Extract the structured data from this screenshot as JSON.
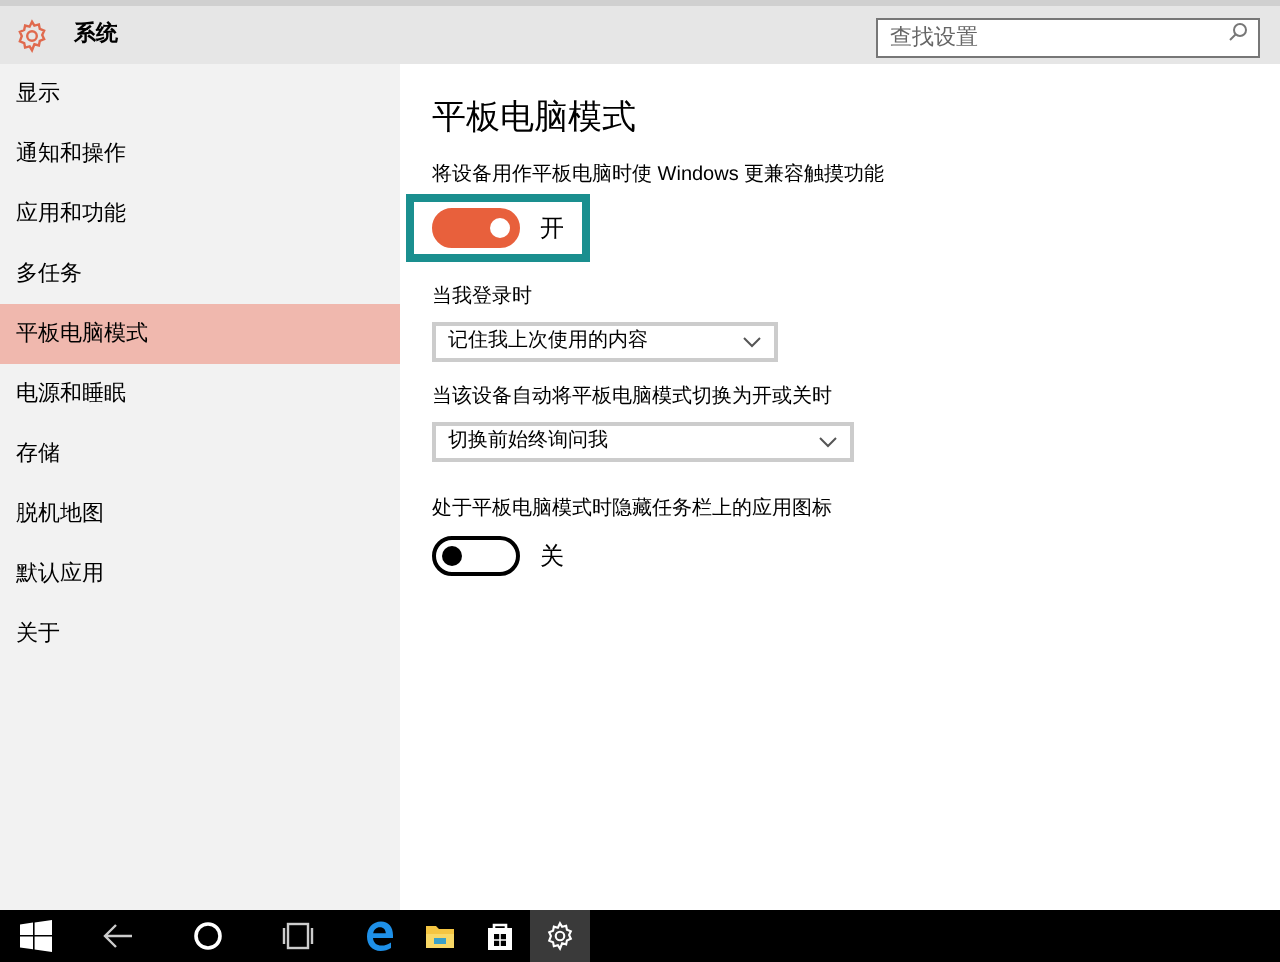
{
  "header": {
    "title": "系统",
    "search": {
      "placeholder": "查找设置"
    }
  },
  "sidebar": {
    "items": [
      {
        "label": "显示",
        "selected": false
      },
      {
        "label": "通知和操作",
        "selected": false
      },
      {
        "label": "应用和功能",
        "selected": false
      },
      {
        "label": "多任务",
        "selected": false
      },
      {
        "label": "平板电脑模式",
        "selected": true
      },
      {
        "label": "电源和睡眠",
        "selected": false
      },
      {
        "label": "存储",
        "selected": false
      },
      {
        "label": "脱机地图",
        "selected": false
      },
      {
        "label": "默认应用",
        "selected": false
      },
      {
        "label": "关于",
        "selected": false
      }
    ]
  },
  "page": {
    "title": "平板电脑模式",
    "settings": [
      {
        "kind": "toggle",
        "label": "将设备用作平板电脑时使 Windows 更兼容触摸功能",
        "on": true,
        "state_text": "开",
        "highlighted": true
      },
      {
        "kind": "dropdown",
        "label": "当我登录时",
        "value": "记住我上次使用的内容",
        "wide": false
      },
      {
        "kind": "dropdown",
        "label": "当该设备自动将平板电脑模式切换为开或关时",
        "value": "切换前始终询问我",
        "wide": true
      },
      {
        "kind": "toggle",
        "label": "处于平板电脑模式时隐藏任务栏上的应用图标",
        "on": false,
        "state_text": "关",
        "highlighted": false
      }
    ]
  },
  "taskbar": {
    "items": [
      {
        "kind": "start",
        "selected": false
      },
      {
        "kind": "back",
        "selected": false
      },
      {
        "kind": "search",
        "selected": false
      },
      {
        "kind": "taskview",
        "selected": false
      },
      {
        "kind": "browser",
        "selected": false
      },
      {
        "kind": "folder",
        "selected": false
      },
      {
        "kind": "store",
        "selected": false
      },
      {
        "kind": "settings",
        "selected": true
      }
    ]
  }
}
